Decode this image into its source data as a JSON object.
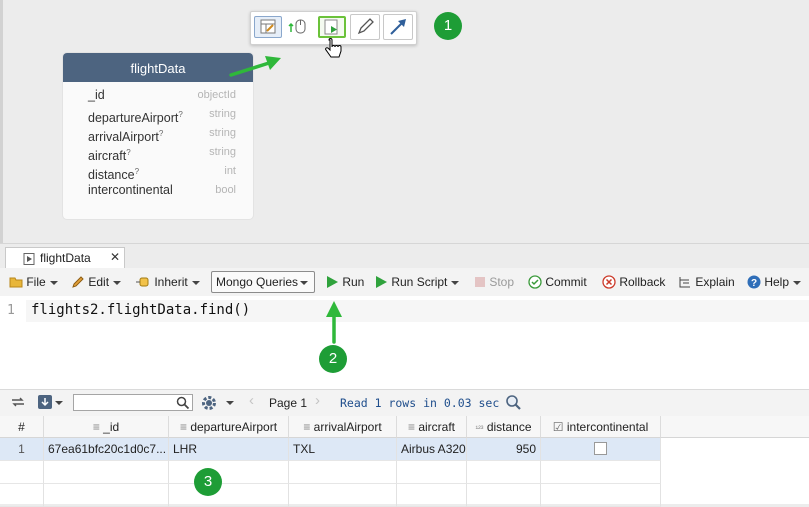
{
  "diagram": {
    "entity": {
      "title": "flightData",
      "fields": [
        {
          "name": "_id",
          "type": "objectId",
          "optional": false
        },
        {
          "name": "departureAirport",
          "type": "string",
          "optional": true
        },
        {
          "name": "arrivalAirport",
          "type": "string",
          "optional": true
        },
        {
          "name": "aircraft",
          "type": "string",
          "optional": true
        },
        {
          "name": "distance",
          "type": "int",
          "optional": true
        },
        {
          "name": "intercontinental",
          "type": "bool",
          "optional": false
        }
      ],
      "optional_mark": "?"
    },
    "floating_toolbar": {
      "buttons": [
        "table-view-icon",
        "mouse-pointer-icon",
        "run-query-icon",
        "pencil-icon",
        "arrow-icon"
      ]
    }
  },
  "badges": [
    "1",
    "2",
    "3"
  ],
  "editor_tab": {
    "label": "flightData",
    "close": "✕"
  },
  "toolbar": {
    "file": "File",
    "edit": "Edit",
    "inherit": "Inherit",
    "mode_select": "Mongo Queries",
    "run": "Run",
    "run_script": "Run Script",
    "stop": "Stop",
    "commit": "Commit",
    "rollback": "Rollback",
    "explain": "Explain",
    "help": "Help"
  },
  "editor": {
    "line_numbers": [
      "1"
    ],
    "code": "flights2.flightData.find()"
  },
  "results_toolbar": {
    "search_value": "",
    "page_label": "Page 1",
    "status": "Read 1 rows in 0.03 sec"
  },
  "grid": {
    "columns": [
      {
        "label": "#",
        "icon": ""
      },
      {
        "label": "_id",
        "icon": "≡"
      },
      {
        "label": "departureAirport",
        "icon": "≡"
      },
      {
        "label": "arrivalAirport",
        "icon": "≡"
      },
      {
        "label": "aircraft",
        "icon": "≡"
      },
      {
        "label": "distance",
        "icon": "¹²³"
      },
      {
        "label": "intercontinental",
        "icon": "☑"
      }
    ],
    "rows": [
      {
        "num": "1",
        "_id": "67ea61bfc20c1d0c7...",
        "departureAirport": "LHR",
        "arrivalAirport": "TXL",
        "aircraft": "Airbus A320",
        "distance": "950",
        "intercontinental": false
      }
    ]
  },
  "colors": {
    "accent_green": "#1e9d36",
    "entity_header": "#4d6480",
    "selected_row": "#dde8f6"
  }
}
